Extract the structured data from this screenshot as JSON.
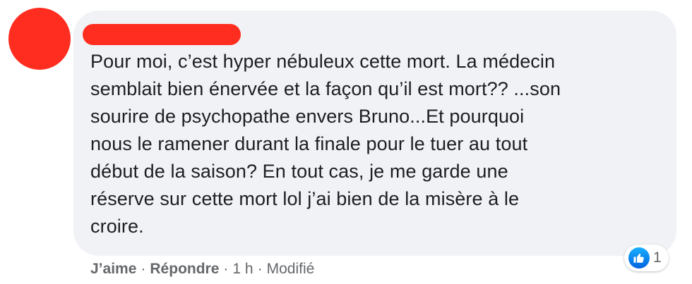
{
  "comment": {
    "lines": [
      "Pour moi, c’est hyper nébuleux cette mort. La médecin",
      "semblait bien énervée et la façon qu’il est mort?? ...son",
      "sourire de psychopathe envers Bruno...Et pourquoi",
      "nous le ramener durant la finale pour le tuer au tout",
      "début de la saison? En tout cas, je me garde une",
      "réserve sur cette mort lol j’ai bien de la misère à le",
      "croire."
    ]
  },
  "reactions": {
    "icon": "like-thumb-icon",
    "count": "1"
  },
  "actions": {
    "like_label": "J’aime",
    "reply_label": "Répondre",
    "time": "1 h",
    "edited": "Modifié",
    "separator": "·"
  },
  "colors": {
    "redaction": "#ff2d1f",
    "bubble": "#f0f2f5",
    "text": "#1c1e21",
    "meta": "#65676b",
    "like_blue": "#1877f2"
  }
}
